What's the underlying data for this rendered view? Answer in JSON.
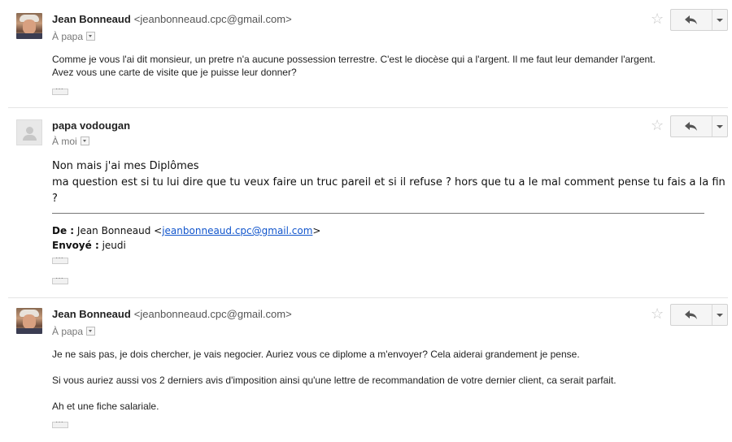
{
  "messages": [
    {
      "sender_name": "Jean Bonneaud",
      "sender_email": "<jeanbonneaud.cpc@gmail.com>",
      "recipient": "À papa",
      "date": "",
      "body": [
        "Comme je vous l'ai dit monsieur, un pretre n'a aucune possession terrestre. C'est le diocèse qui a l'argent. Il me faut leur demander l'argent.",
        "Avez vous une carte de visite que je puisse leur donner?"
      ]
    },
    {
      "sender_name": "papa vodougan",
      "sender_email": "",
      "recipient": "À moi",
      "date": "",
      "body": [
        "Non mais j'ai mes Diplômes",
        "ma question est si tu lui dire que tu veux faire un truc pareil et si il refuse ? hors que tu a le mal comment pense tu fais a la fin",
        "?"
      ],
      "quote": {
        "from_label": "De :",
        "from_name": "Jean Bonneaud <",
        "from_email": "jeanbonneaud.cpc@gmail.com",
        "from_close": ">",
        "sent_label": "Envoyé :",
        "sent_value": "jeudi"
      }
    },
    {
      "sender_name": "Jean Bonneaud",
      "sender_email": "<jeanbonneaud.cpc@gmail.com>",
      "recipient": "À papa",
      "date": "",
      "body": [
        "Je ne sais pas, je dois chercher, je vais negocier. Auriez vous ce diplome a m'envoyer? Cela aiderai grandement je pense.",
        "Si vous auriez aussi vos 2 derniers avis d'imposition ainsi qu'une lettre de recommandation de votre dernier client, ca serait parfait.",
        "Ah et une fiche salariale."
      ]
    }
  ],
  "icons": {
    "star": "star-icon",
    "reply": "reply-icon",
    "more": "more-options-icon",
    "ellipsis": "show-trimmed-content-icon"
  }
}
